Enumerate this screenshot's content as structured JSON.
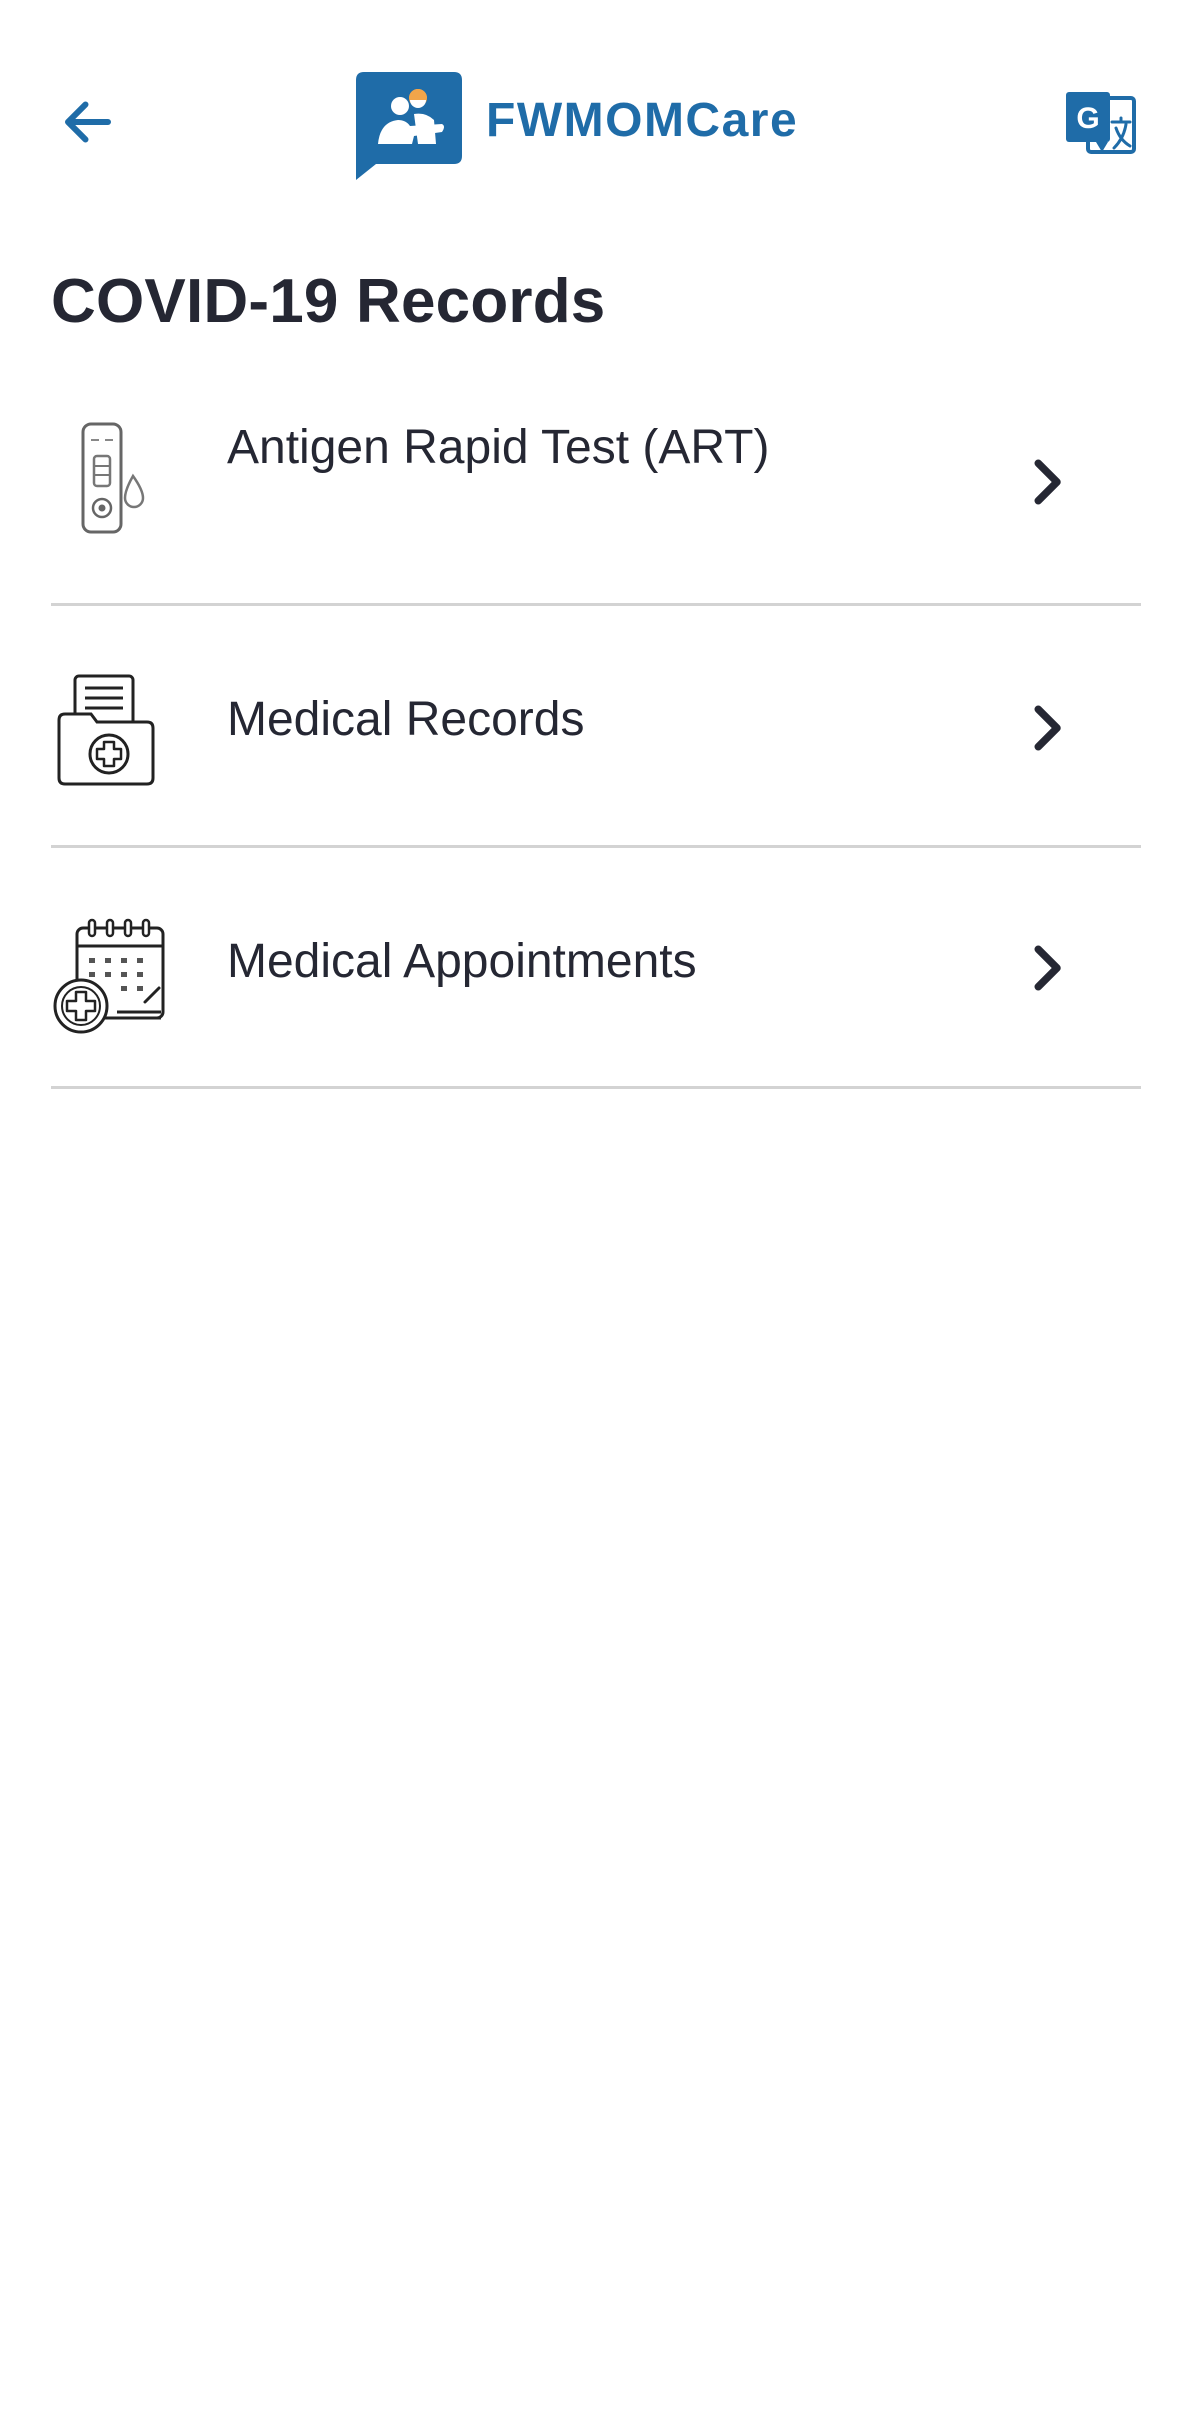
{
  "header": {
    "back_icon": "arrow-left-icon",
    "logo_icon": "fwmomcare-logo-icon",
    "app_name": "FWMOMCare",
    "translate_icon": "google-translate-icon",
    "brand_color": "#1f6ca8"
  },
  "page": {
    "title": "COVID-19 Records"
  },
  "menu": {
    "items": [
      {
        "label": "Antigen Rapid Test (ART)",
        "icon": "antigen-test-kit-icon",
        "chevron": "chevron-right-icon"
      },
      {
        "label": "Medical Records",
        "icon": "medical-folder-icon",
        "chevron": "chevron-right-icon"
      },
      {
        "label": "Medical Appointments",
        "icon": "medical-calendar-icon",
        "chevron": "chevron-right-icon"
      }
    ]
  },
  "colors": {
    "text": "#252733",
    "divider": "#d3d3d3",
    "background": "#ffffff"
  }
}
